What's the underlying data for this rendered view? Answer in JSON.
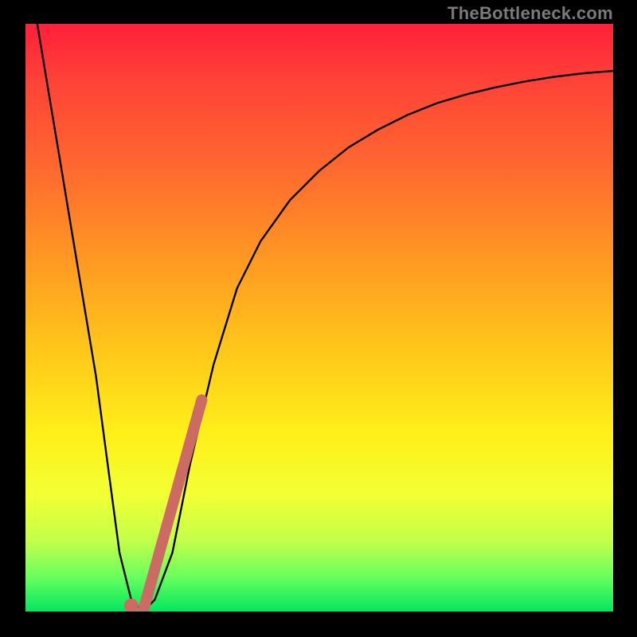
{
  "attribution": "TheBottleneck.com",
  "chart_data": {
    "type": "line",
    "title": "",
    "xlabel": "",
    "ylabel": "",
    "xlim": [
      0,
      100
    ],
    "ylim": [
      0,
      100
    ],
    "grid": false,
    "legend": false,
    "background": "gradient-red-yellow-green",
    "series": [
      {
        "name": "bottleneck-curve",
        "x": [
          2,
          4,
          6,
          8,
          10,
          12,
          14,
          16,
          18,
          20,
          22,
          25,
          28,
          32,
          36,
          40,
          45,
          50,
          55,
          60,
          65,
          70,
          75,
          80,
          85,
          90,
          95,
          100
        ],
        "y": [
          100,
          88,
          76,
          64,
          52,
          40,
          25,
          10,
          2,
          0,
          2,
          10,
          25,
          42,
          55,
          63,
          70,
          75,
          79,
          82,
          84.5,
          86.5,
          88,
          89.2,
          90.2,
          91,
          91.6,
          92
        ]
      }
    ],
    "markers": [
      {
        "name": "highlighted-range",
        "x_start": 20,
        "y_start": 0,
        "x_end": 30,
        "y_end": 36
      },
      {
        "name": "minimum-point",
        "x": 18,
        "y": 1
      }
    ]
  }
}
